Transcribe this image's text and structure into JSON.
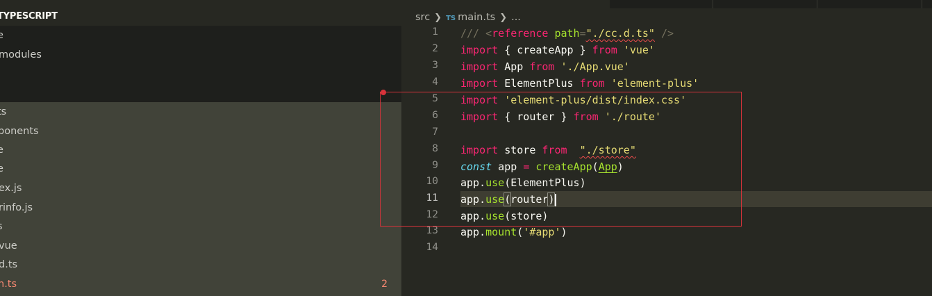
{
  "sidebar": {
    "section_title": "TYPESCRIPT",
    "items": [
      {
        "label": "e"
      },
      {
        "label": "modules"
      },
      {
        "label": "ts"
      },
      {
        "label": "ponents"
      },
      {
        "label": "e"
      },
      {
        "label": "e"
      },
      {
        "label": "ex.js"
      },
      {
        "label": "rinfo.js"
      },
      {
        "label": "s"
      },
      {
        "label": "vue"
      },
      {
        "label": "d.ts"
      },
      {
        "label": "n.ts",
        "badge": "2"
      }
    ]
  },
  "breadcrumb": {
    "folder": "src",
    "ts_label": "TS",
    "file": "main.ts",
    "more": "..."
  },
  "editor": {
    "line_numbers": [
      "1",
      "2",
      "3",
      "4",
      "5",
      "6",
      "7",
      "8",
      "9",
      "10",
      "11",
      "12",
      "13",
      "14"
    ],
    "active_line": "11",
    "lines": {
      "l1": [
        "/// <",
        "reference",
        " ",
        "path",
        "=",
        "\"./cc.d.ts\"",
        " />"
      ],
      "l2": [
        "import",
        " { createApp } ",
        "from",
        " ",
        "'vue'"
      ],
      "l3": [
        "import",
        " App ",
        "from",
        " ",
        "'./App.vue'"
      ],
      "l4": [
        "import",
        " ElementPlus ",
        "from",
        " ",
        "'element-plus'"
      ],
      "l5": [
        "import",
        " ",
        "'element-plus/dist/index.css'"
      ],
      "l6": [
        "import",
        " { router } ",
        "from",
        " ",
        "'./route'"
      ],
      "l8": [
        "import",
        " store ",
        "from",
        "  ",
        "\"./store\""
      ],
      "l9": [
        "const",
        " app ",
        "=",
        " ",
        "createApp",
        "(",
        "App",
        ")"
      ],
      "l10": [
        "app.",
        "use",
        "(ElementPlus)"
      ],
      "l11": [
        "app.",
        "use",
        "(",
        "router",
        ")"
      ],
      "l12": [
        "app.",
        "use",
        "(store)"
      ],
      "l13": [
        "app.",
        "mount",
        "(",
        "'#app'",
        ")"
      ]
    }
  },
  "colors": {
    "annotation_box": "#d9333b",
    "keyword": "#f92672",
    "string": "#e6db74",
    "function": "#a6e22e"
  }
}
